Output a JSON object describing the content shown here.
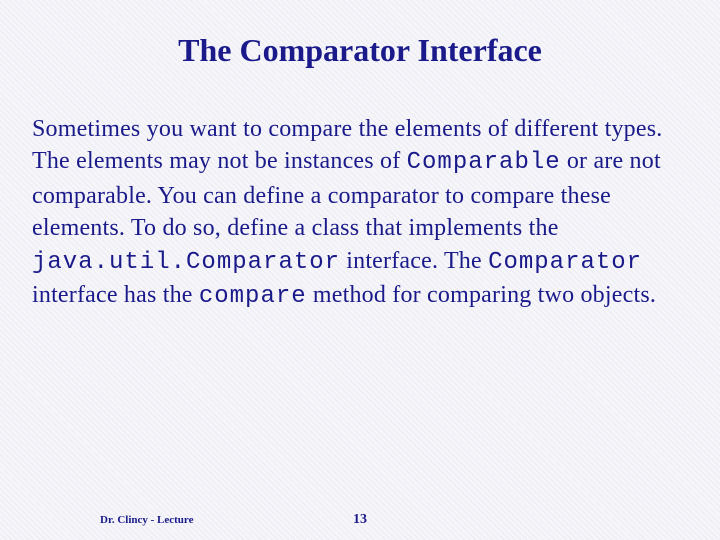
{
  "title": "The Comparator Interface",
  "body": {
    "p1a": "Sometimes you want to compare the elements of different types. The elements may not be instances of ",
    "code1": "Comparable",
    "p1b": " or are not comparable. You can define a comparator to compare these elements. To do so, define a class that implements the ",
    "code2": "java.util.Comparator",
    "p1c": " interface. The ",
    "code3": "Comparator",
    "p1d": " interface has the ",
    "code4": "compare",
    "p1e": " method for comparing two objects."
  },
  "footer": {
    "author": "Dr. Clincy - Lecture",
    "page": "13"
  }
}
